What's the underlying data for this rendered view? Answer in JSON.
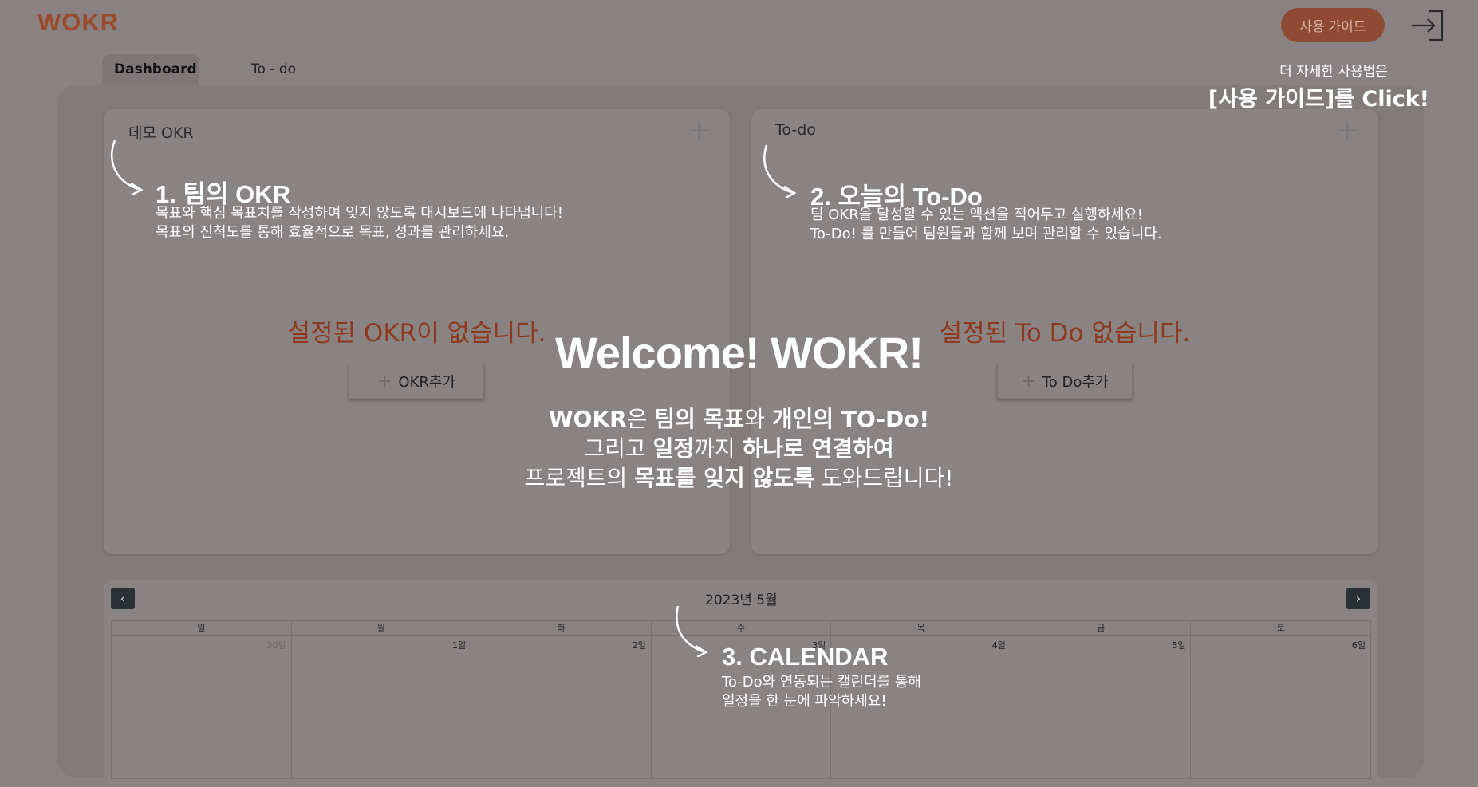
{
  "header": {
    "logo": "WOKR",
    "guide_button": "사용 가이드",
    "tabs": [
      "Dashboard",
      "To - do"
    ]
  },
  "okr_card": {
    "title": "데모 OKR",
    "empty_message": "설정된 OKR이 없습니다.",
    "add_button": "OKR추가"
  },
  "todo_card": {
    "title": "To-do",
    "empty_message": "설정된 To Do 없습니다.",
    "add_button": "To Do추가"
  },
  "calendar": {
    "month_label": "2023년 5월",
    "weekdays": [
      "일",
      "월",
      "화",
      "수",
      "목",
      "금",
      "토"
    ],
    "first_row_dates": [
      "30일",
      "1일",
      "2일",
      "3일",
      "4일",
      "5일",
      "6일"
    ]
  },
  "overlay": {
    "guide_hint_line1": "더 자세한 사용법은",
    "guide_hint_line2": "[사용 가이드]를 Click!",
    "step1_title": "1. 팀의 OKR",
    "step1_desc1": "목표와 핵심 목표치를 작성하여 잊지 않도록 대시보드에 나타냅니다!",
    "step1_desc2": "목표의 진척도를 통해 효율적으로 목표, 성과를 관리하세요.",
    "step2_title": "2. 오늘의 To-Do",
    "step2_desc1": "팀 OKR을 달성할 수 있는 액션을 적어두고 실행하세요!",
    "step2_desc2": "To-Do! 를 만들어 팀원들과 함께 보며 관리할 수 있습니다.",
    "step3_title": "3. CALENDAR",
    "step3_desc1": "To-Do와 연동되는 캘린더를 통해",
    "step3_desc2": "일정을 한 눈에 파악하세요!",
    "welcome_title": "Welcome! WOKR!",
    "w1_a": "WOKR",
    "w1_b": "은 ",
    "w1_c": "팀의 목표",
    "w1_d": "와 ",
    "w1_e": "개인의 TO-Do!",
    "w2_a": "그리고 ",
    "w2_b": "일정",
    "w2_c": "까지 ",
    "w2_d": "하나로 연결하여",
    "w3_a": "프로젝트의 ",
    "w3_b": "목표를 잊지 않도록",
    "w3_c": " 도와드립니다!"
  },
  "colors": {
    "backdrop": "#8a8282",
    "brand": "#9b4a2a",
    "empty_text": "#8f3a1e",
    "overlay_text": "#ffffff"
  }
}
